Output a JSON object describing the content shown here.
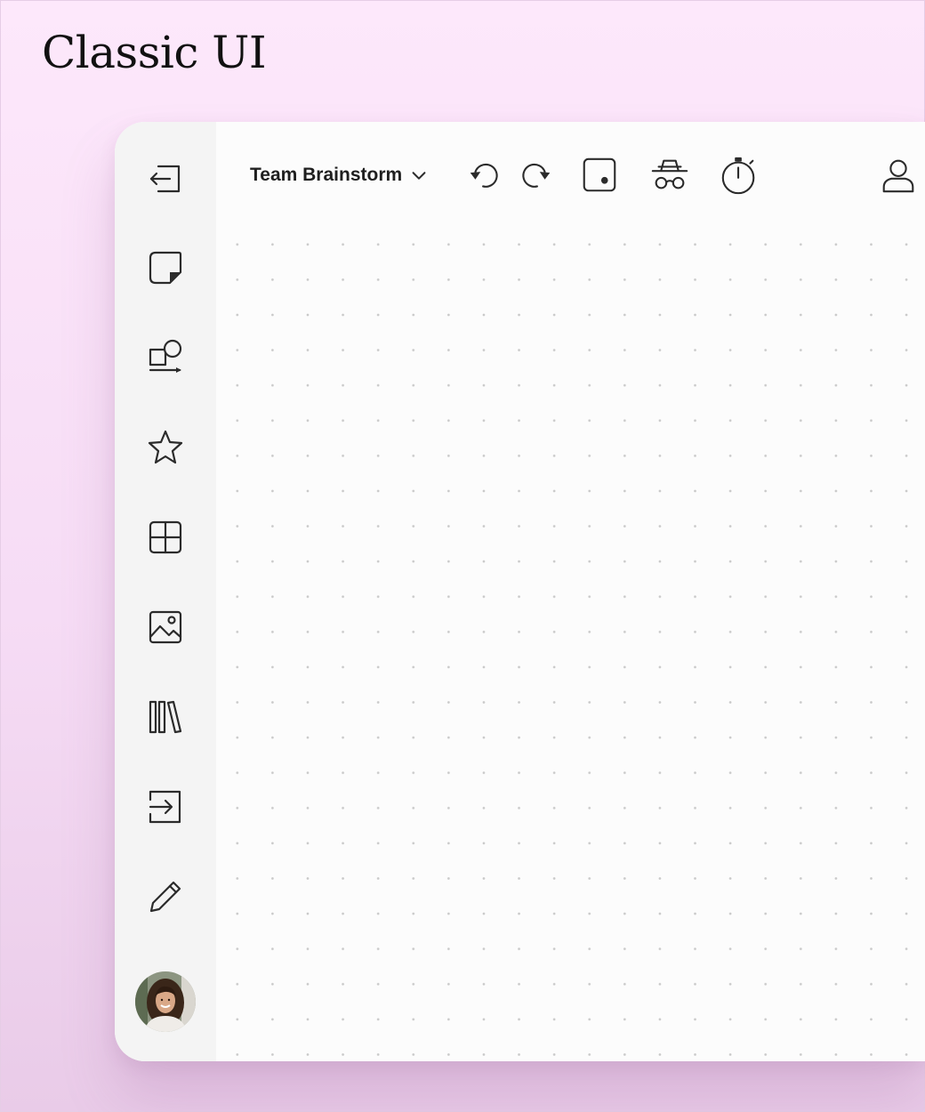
{
  "page": {
    "heading": "Classic UI"
  },
  "toolbar": {
    "board_name": "Team Brainstorm",
    "icons": [
      "undo-icon",
      "redo-icon",
      "dice-icon",
      "incognito-icon",
      "timer-icon",
      "user-icon"
    ]
  },
  "sidebar": {
    "items": [
      {
        "icon": "exit-icon"
      },
      {
        "icon": "sticky-note-icon"
      },
      {
        "icon": "shapes-icon"
      },
      {
        "icon": "star-icon"
      },
      {
        "icon": "grid-icon"
      },
      {
        "icon": "image-icon"
      },
      {
        "icon": "library-icon"
      },
      {
        "icon": "import-icon"
      },
      {
        "icon": "pencil-icon"
      }
    ],
    "avatar": "user-avatar"
  },
  "colors": {
    "background": "#fde8fb",
    "sidebar": "#f4f4f4",
    "canvas": "#fcfcfc",
    "icon": "#2b2b2b",
    "grid_dot": "#c9c9c9"
  }
}
